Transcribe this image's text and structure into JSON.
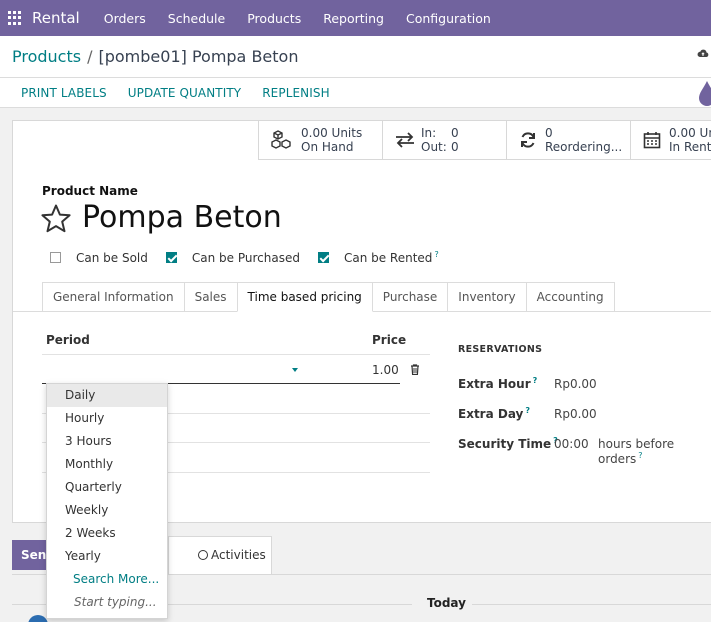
{
  "topbar": {
    "brand": "Rental",
    "menu": [
      "Orders",
      "Schedule",
      "Products",
      "Reporting",
      "Configuration"
    ]
  },
  "breadcrumb": {
    "parent": "Products",
    "separator": "/",
    "current": "[pombe01] Pompa Beton"
  },
  "actions": [
    "PRINT LABELS",
    "UPDATE QUANTITY",
    "REPLENISH"
  ],
  "stats": {
    "units_value": "0.00 Units",
    "units_label": "On Hand",
    "in_label": "In:",
    "in_value": "0",
    "out_label": "Out:",
    "out_value": "0",
    "reorder_value": "0",
    "reorder_label": "Reordering...",
    "rent_value": "0.00 Un",
    "rent_label": "In Renta"
  },
  "product": {
    "name_label": "Product Name",
    "name": "Pompa Beton"
  },
  "checks": {
    "sold": "Can be Sold",
    "purchased": "Can be Purchased",
    "rented": "Can be Rented",
    "help_mark": "?"
  },
  "tabs": [
    "General Information",
    "Sales",
    "Time based pricing",
    "Purchase",
    "Inventory",
    "Accounting"
  ],
  "pricing": {
    "col_period": "Period",
    "col_price": "Price",
    "price_value": "1.00"
  },
  "reservations": {
    "title": "RESERVATIONS",
    "extra_hour_label": "Extra Hour",
    "extra_hour_value": "Rp0.00",
    "extra_day_label": "Extra Day",
    "extra_day_value": "Rp0.00",
    "security_label": "Security Time",
    "security_value": "00:00",
    "security_suffix": "hours before orders",
    "help_mark": "?"
  },
  "dropdown": {
    "options": [
      "Daily",
      "Hourly",
      "3 Hours",
      "Monthly",
      "Quarterly",
      "Weekly",
      "2 Weeks",
      "Yearly"
    ],
    "search_more": "Search More...",
    "hint": "Start typing..."
  },
  "chatter": {
    "send": "Send",
    "activities": "Activities",
    "today": "Today"
  },
  "colors": {
    "brand": "#71639e",
    "accent": "#017e84"
  }
}
